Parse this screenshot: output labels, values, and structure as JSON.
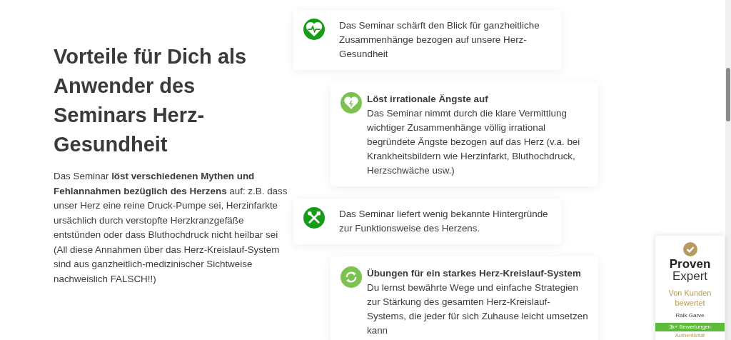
{
  "heading": "Vorteile für Dich als Anwender des Seminars Herz-Gesundheit",
  "intro": "Das Seminar **löst verschiedenen Mythen und Fehlannahmen bezüglich des Herzens** auf: z.B. dass unser Herz eine reine Druck-Pumpe sei, Herzinfarkte ursächlich durch verstopfte Herzkranzgefäße entstünden oder dass Bluthochdruck nicht heilbar sei (All diese Annahmen über das Herz-Kreislauf-System sind aus ganzheitlich-medizinischer Sichtweise nachweislich FALSCH!!)",
  "benefits": [
    {
      "kind": "heart-pulse",
      "color": "#179c17",
      "offset": false,
      "text": "Das Seminar schärft den Blick für ganzheitliche Zusammenhänge bezogen auf unsere Herz-Gesundheit"
    },
    {
      "kind": "heart",
      "color": "#7cc24f",
      "offset": true,
      "title": "Löst irrationale Ängste auf",
      "text": "Das Seminar nimmt durch die klare Vermittlung wichtiger Zusammenhänge völlig irrational begründete Ängste bezogen auf das Herz (v.a. bei Krankheitsbildern wie Herzinfarkt, Bluthochdruck, Herzschwäche usw.)"
    },
    {
      "kind": "tools",
      "color": "#179c17",
      "offset": false,
      "text": "Das Seminar liefert wenig bekannte Hintergründe zur Funktionsweise des Herzens."
    },
    {
      "kind": "cycle",
      "color": "#7cc24f",
      "offset": true,
      "title": "Übungen für ein starkes Herz-Kreislauf-System",
      "text": "Du lernst bewährte Wege und einfache Strategien zur Stärkung des gesamten Herz-Kreislauf-Systems, die jeder für sich Zuhause leicht umsetzen kann"
    }
  ],
  "rating_widget": {
    "brand_line_1": "Proven",
    "brand_line_2": "Expert",
    "tagline": "Von Kunden bewertet",
    "name": "Raik Garve",
    "count": "3k+ Bewertungen",
    "criterion": "Authentizität"
  }
}
